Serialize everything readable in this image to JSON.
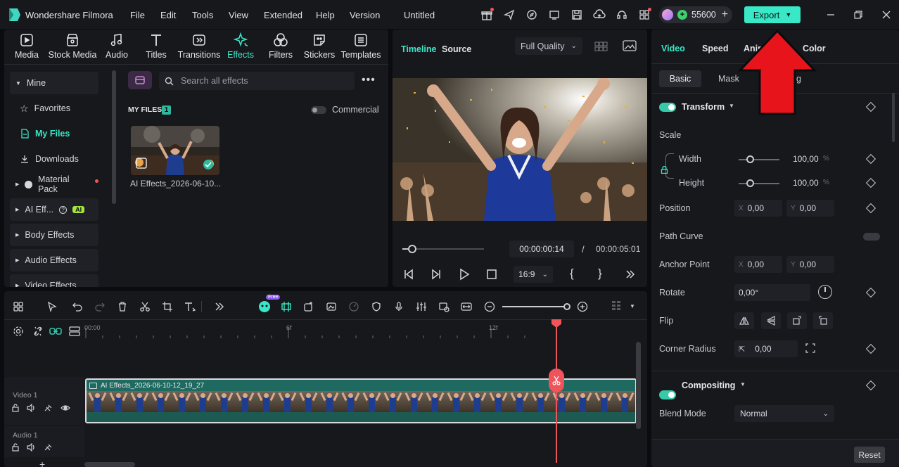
{
  "app": {
    "name": "Wondershare Filmora",
    "project": "Untitled"
  },
  "menu": [
    "File",
    "Edit",
    "Tools",
    "View",
    "Extended",
    "Help",
    "Version"
  ],
  "credits": {
    "value": "55600",
    "plus": "+"
  },
  "export_label": "Export",
  "library": {
    "tabs": [
      "Media",
      "Stock Media",
      "Audio",
      "Titles",
      "Transitions",
      "Effects",
      "Filters",
      "Stickers",
      "Templates"
    ],
    "active_tab": "Effects",
    "sidebar": {
      "mine": "Mine",
      "favorites": "Favorites",
      "my_files": "My Files",
      "downloads": "Downloads",
      "material_pack": "Material Pack",
      "ai_effects": "AI Eff...",
      "ai_badge": "AI",
      "body_effects": "Body Effects",
      "audio_effects": "Audio Effects",
      "video_effects": "Video Effects"
    },
    "search_placeholder": "Search all effects",
    "section_title": "MY FILES",
    "section_count": "1",
    "commercial_label": "Commercial",
    "file_name": "AI Effects_2026-06-10..."
  },
  "player": {
    "tab_timeline": "Timeline",
    "tab_source": "Source",
    "quality": "Full Quality",
    "current_time": "00:00:00:14",
    "separator": "/",
    "total_time": "00:00:05:01",
    "aspect": "16:9",
    "progress": 0.12
  },
  "properties": {
    "tabs": [
      "Video",
      "Speed",
      "Anim",
      "Color"
    ],
    "subtabs": [
      "Basic",
      "Mask",
      "g"
    ],
    "transform": "Transform",
    "scale": "Scale",
    "width_label": "Width",
    "width_value": "100,00",
    "height_label": "Height",
    "height_value": "100,00",
    "percent": "%",
    "position_label": "Position",
    "x_label": "X",
    "y_label": "Y",
    "pos_x": "0,00",
    "pos_y": "0,00",
    "path_curve": "Path Curve",
    "anchor_label": "Anchor Point",
    "anchor_x": "0,00",
    "anchor_y": "0,00",
    "rotate_label": "Rotate",
    "rotate_value": "0,00°",
    "flip_label": "Flip",
    "corner_label": "Corner Radius",
    "corner_value": "0,00",
    "compositing": "Compositing",
    "blend_label": "Blend Mode",
    "blend_value": "Normal",
    "reset": "Reset"
  },
  "timeline": {
    "ruler": [
      "00:00",
      "6f",
      "12f"
    ],
    "free_badge": "Free",
    "video_track": "Video 1",
    "audio_track": "Audio 1",
    "clip_name": "AI Effects_2026-06-10-12_19_27"
  },
  "colors": {
    "accent": "#38e8c6",
    "playhead": "#f0545b",
    "annotation_arrow": "#e8141c"
  }
}
